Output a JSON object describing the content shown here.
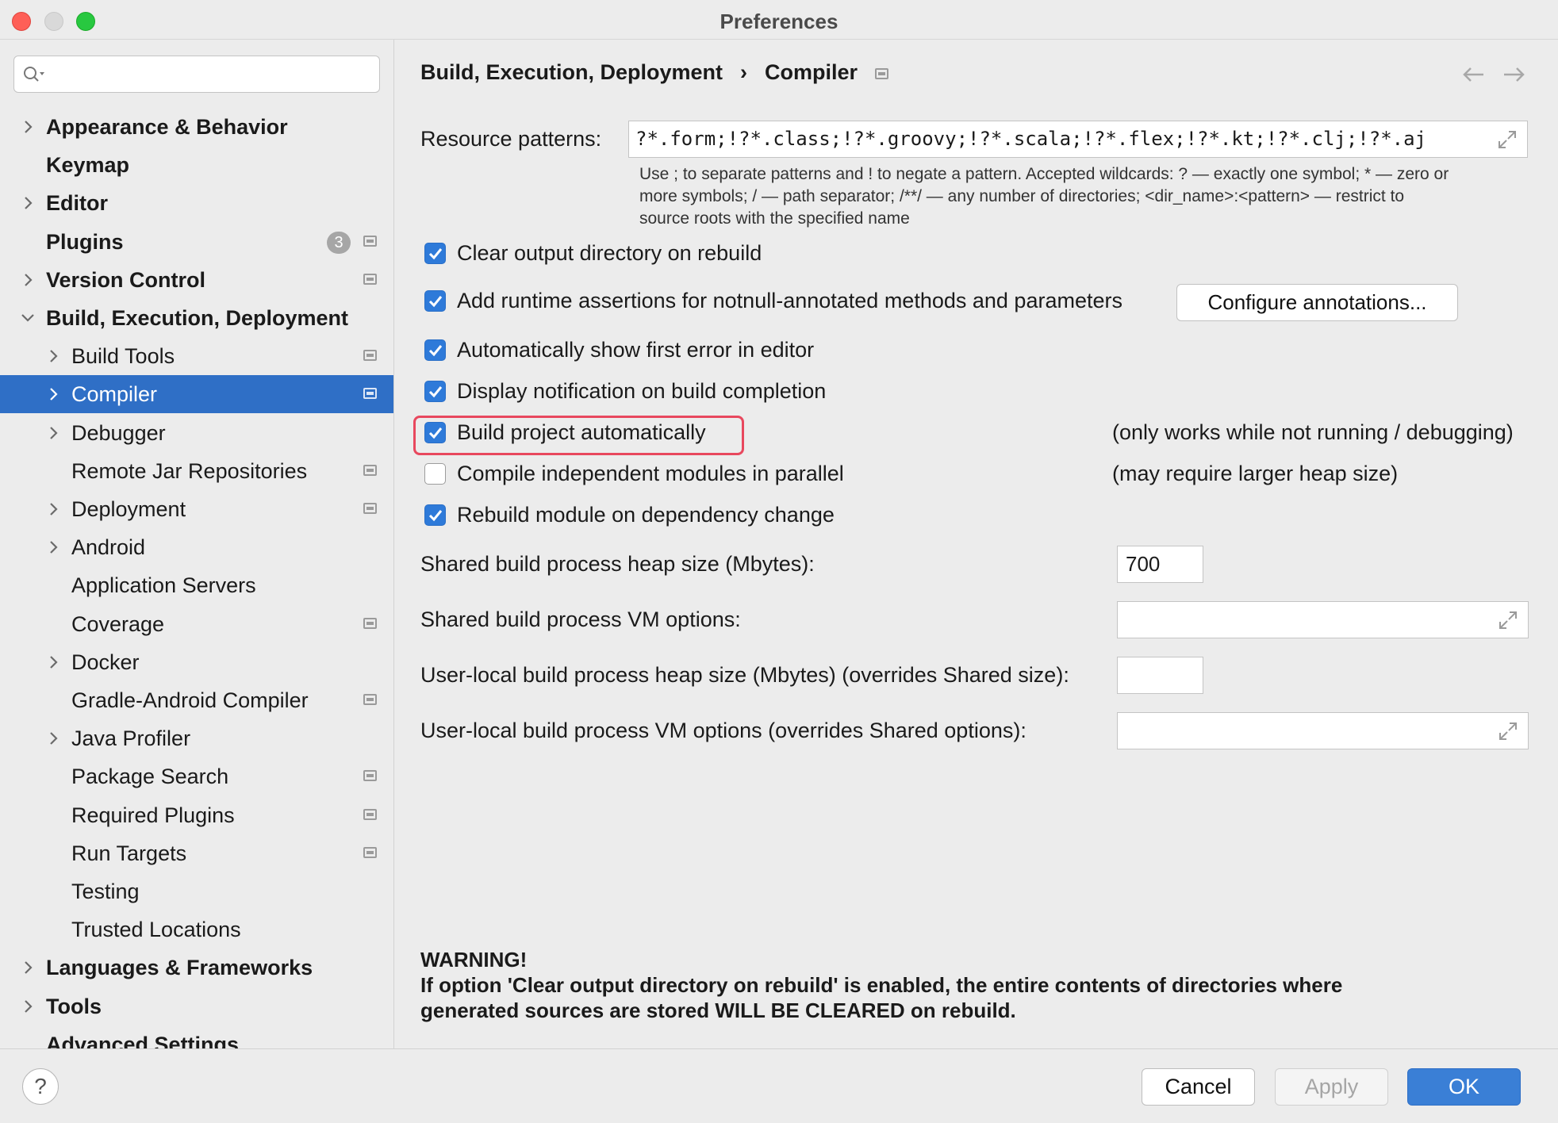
{
  "window": {
    "title": "Preferences"
  },
  "sidebar": {
    "search_placeholder": "",
    "items": [
      {
        "label": "Appearance & Behavior",
        "level": 0,
        "expandable": true,
        "expanded": false
      },
      {
        "label": "Keymap",
        "level": 0,
        "expandable": false
      },
      {
        "label": "Editor",
        "level": 0,
        "expandable": true,
        "expanded": false
      },
      {
        "label": "Plugins",
        "level": 0,
        "expandable": false,
        "badge": "3",
        "project_icon": true
      },
      {
        "label": "Version Control",
        "level": 0,
        "expandable": true,
        "expanded": false,
        "project_icon": true
      },
      {
        "label": "Build, Execution, Deployment",
        "level": 0,
        "expandable": true,
        "expanded": true
      },
      {
        "label": "Build Tools",
        "level": 1,
        "expandable": true,
        "project_icon": true
      },
      {
        "label": "Compiler",
        "level": 1,
        "expandable": true,
        "selected": true,
        "project_icon": true
      },
      {
        "label": "Debugger",
        "level": 1,
        "expandable": true
      },
      {
        "label": "Remote Jar Repositories",
        "level": 1,
        "expandable": false,
        "project_icon": true
      },
      {
        "label": "Deployment",
        "level": 1,
        "expandable": true,
        "project_icon": true
      },
      {
        "label": "Android",
        "level": 1,
        "expandable": true
      },
      {
        "label": "Application Servers",
        "level": 1,
        "expandable": false
      },
      {
        "label": "Coverage",
        "level": 1,
        "expandable": false,
        "project_icon": true
      },
      {
        "label": "Docker",
        "level": 1,
        "expandable": true
      },
      {
        "label": "Gradle-Android Compiler",
        "level": 1,
        "expandable": false,
        "project_icon": true
      },
      {
        "label": "Java Profiler",
        "level": 1,
        "expandable": true
      },
      {
        "label": "Package Search",
        "level": 1,
        "expandable": false,
        "project_icon": true
      },
      {
        "label": "Required Plugins",
        "level": 1,
        "expandable": false,
        "project_icon": true
      },
      {
        "label": "Run Targets",
        "level": 1,
        "expandable": false,
        "project_icon": true
      },
      {
        "label": "Testing",
        "level": 1,
        "expandable": false
      },
      {
        "label": "Trusted Locations",
        "level": 1,
        "expandable": false
      },
      {
        "label": "Languages & Frameworks",
        "level": 0,
        "expandable": true,
        "expanded": false
      },
      {
        "label": "Tools",
        "level": 0,
        "expandable": true,
        "expanded": false
      },
      {
        "label": "Advanced Settings",
        "level": 0,
        "expandable": false
      }
    ]
  },
  "main": {
    "breadcrumb": {
      "parent": "Build, Execution, Deployment",
      "separator": "›",
      "current": "Compiler"
    },
    "resource_patterns": {
      "label": "Resource patterns:",
      "value": "?*.form;!?*.class;!?*.groovy;!?*.scala;!?*.flex;!?*.kt;!?*.clj;!?*.aj",
      "hint_line1": "Use ; to separate patterns and ! to negate a pattern. Accepted wildcards: ? — exactly one symbol; * — zero or",
      "hint_line2": "more symbols; / — path separator; /**/ — any number of directories; <dir_name>:<pattern> — restrict to",
      "hint_line3": "source roots with the specified name"
    },
    "options": [
      {
        "label": "Clear output directory on rebuild",
        "checked": true
      },
      {
        "label": "Add runtime assertions for notnull-annotated methods and parameters",
        "checked": true
      },
      {
        "label": "Automatically show first error in editor",
        "checked": true
      },
      {
        "label": "Display notification on build completion",
        "checked": true
      },
      {
        "label": "Build project automatically",
        "checked": true,
        "note": "(only works while not running / debugging)"
      },
      {
        "label": "Compile independent modules in parallel",
        "checked": false,
        "note": "(may require larger heap size)"
      },
      {
        "label": "Rebuild module on dependency change",
        "checked": true
      }
    ],
    "configure_annotations_label": "Configure annotations...",
    "shared_heap": {
      "label": "Shared build process heap size (Mbytes):",
      "value": "700"
    },
    "shared_vm": {
      "label": "Shared build process VM options:",
      "value": ""
    },
    "user_heap": {
      "label": "User-local build process heap size (Mbytes) (overrides Shared size):",
      "value": ""
    },
    "user_vm": {
      "label": "User-local build process VM options (overrides Shared options):",
      "value": ""
    },
    "warning": {
      "title": "WARNING!",
      "line1": "If option 'Clear output directory on rebuild' is enabled, the entire contents of directories where",
      "line2": "generated sources are stored WILL BE CLEARED on rebuild."
    }
  },
  "footer": {
    "help": "?",
    "cancel": "Cancel",
    "apply": "Apply",
    "ok": "OK"
  },
  "colors": {
    "selection": "#2f6fc6",
    "checkbox": "#2e7ad9",
    "highlight": "#e8485e",
    "ok_button": "#3a7fd6"
  }
}
